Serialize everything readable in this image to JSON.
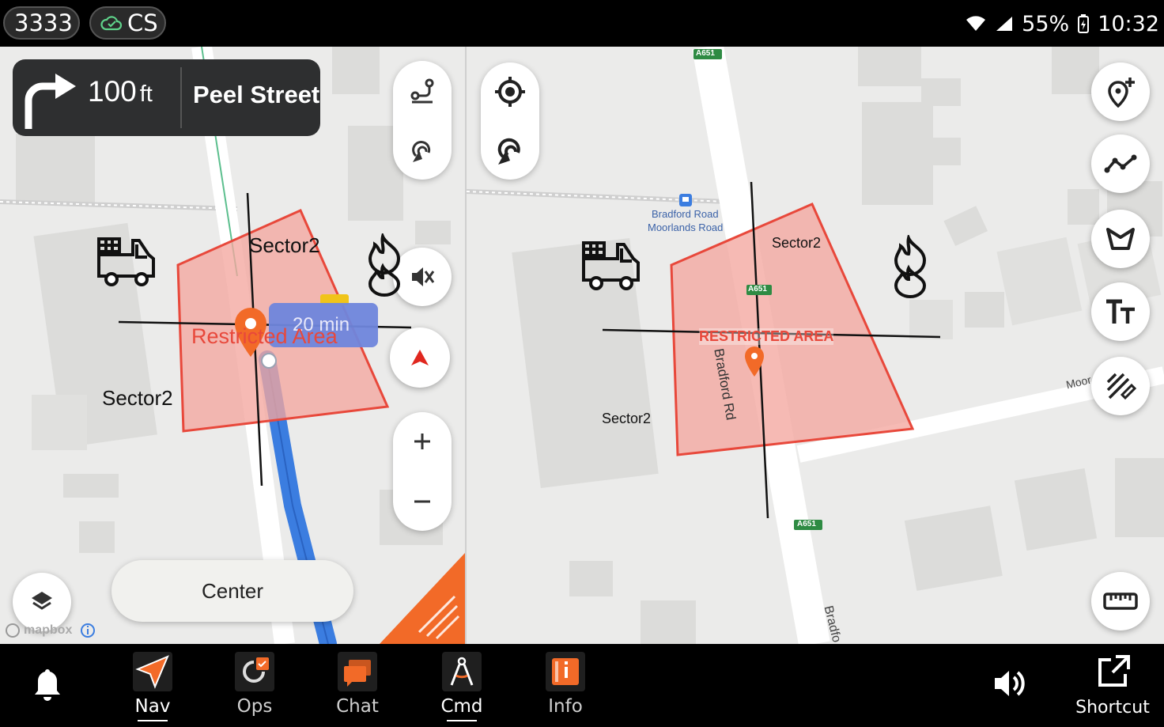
{
  "status_bar": {
    "unit_id": "3333",
    "sync_label": "CS",
    "battery": "55%",
    "time": "10:32"
  },
  "left_map": {
    "turn": {
      "distance": "100",
      "unit": "ft",
      "street": "Peel Street"
    },
    "labels": {
      "sector_top": "Sector2",
      "sector_left": "Sector2",
      "restricted": "Restricted Area",
      "eta": "20 min"
    },
    "center_label": "Center",
    "attribution": "mapbox"
  },
  "right_map": {
    "labels": {
      "sector_top": "Sector2",
      "sector_left": "Sector2",
      "restricted": "RESTRICTED AREA",
      "bus_stop_line1": "Bradford Road",
      "bus_stop_line2": "Moorlands Road",
      "road_vertical": "Bradford Rd",
      "road_bottom": "Bradfo",
      "road_right": "Moor",
      "shield_top": "A651",
      "shield_mid": "A651",
      "shield_bottom": "A651"
    }
  },
  "nav": {
    "items": [
      {
        "label": "Nav",
        "icon": "navigation-arrow-icon",
        "active": true
      },
      {
        "label": "Ops",
        "icon": "ops-icon",
        "active": false
      },
      {
        "label": "Chat",
        "icon": "chat-icon",
        "active": false
      },
      {
        "label": "Cmd",
        "icon": "command-compass-icon",
        "active": true
      },
      {
        "label": "Info",
        "icon": "info-book-icon",
        "active": false
      }
    ],
    "shortcut_label": "Shortcut"
  },
  "colors": {
    "accent": "#f26a28",
    "restricted_fill": "#f4a79f",
    "restricted_stroke": "#e8483b",
    "route": "#3b7de0",
    "eta_badge": "#6f86dd"
  }
}
